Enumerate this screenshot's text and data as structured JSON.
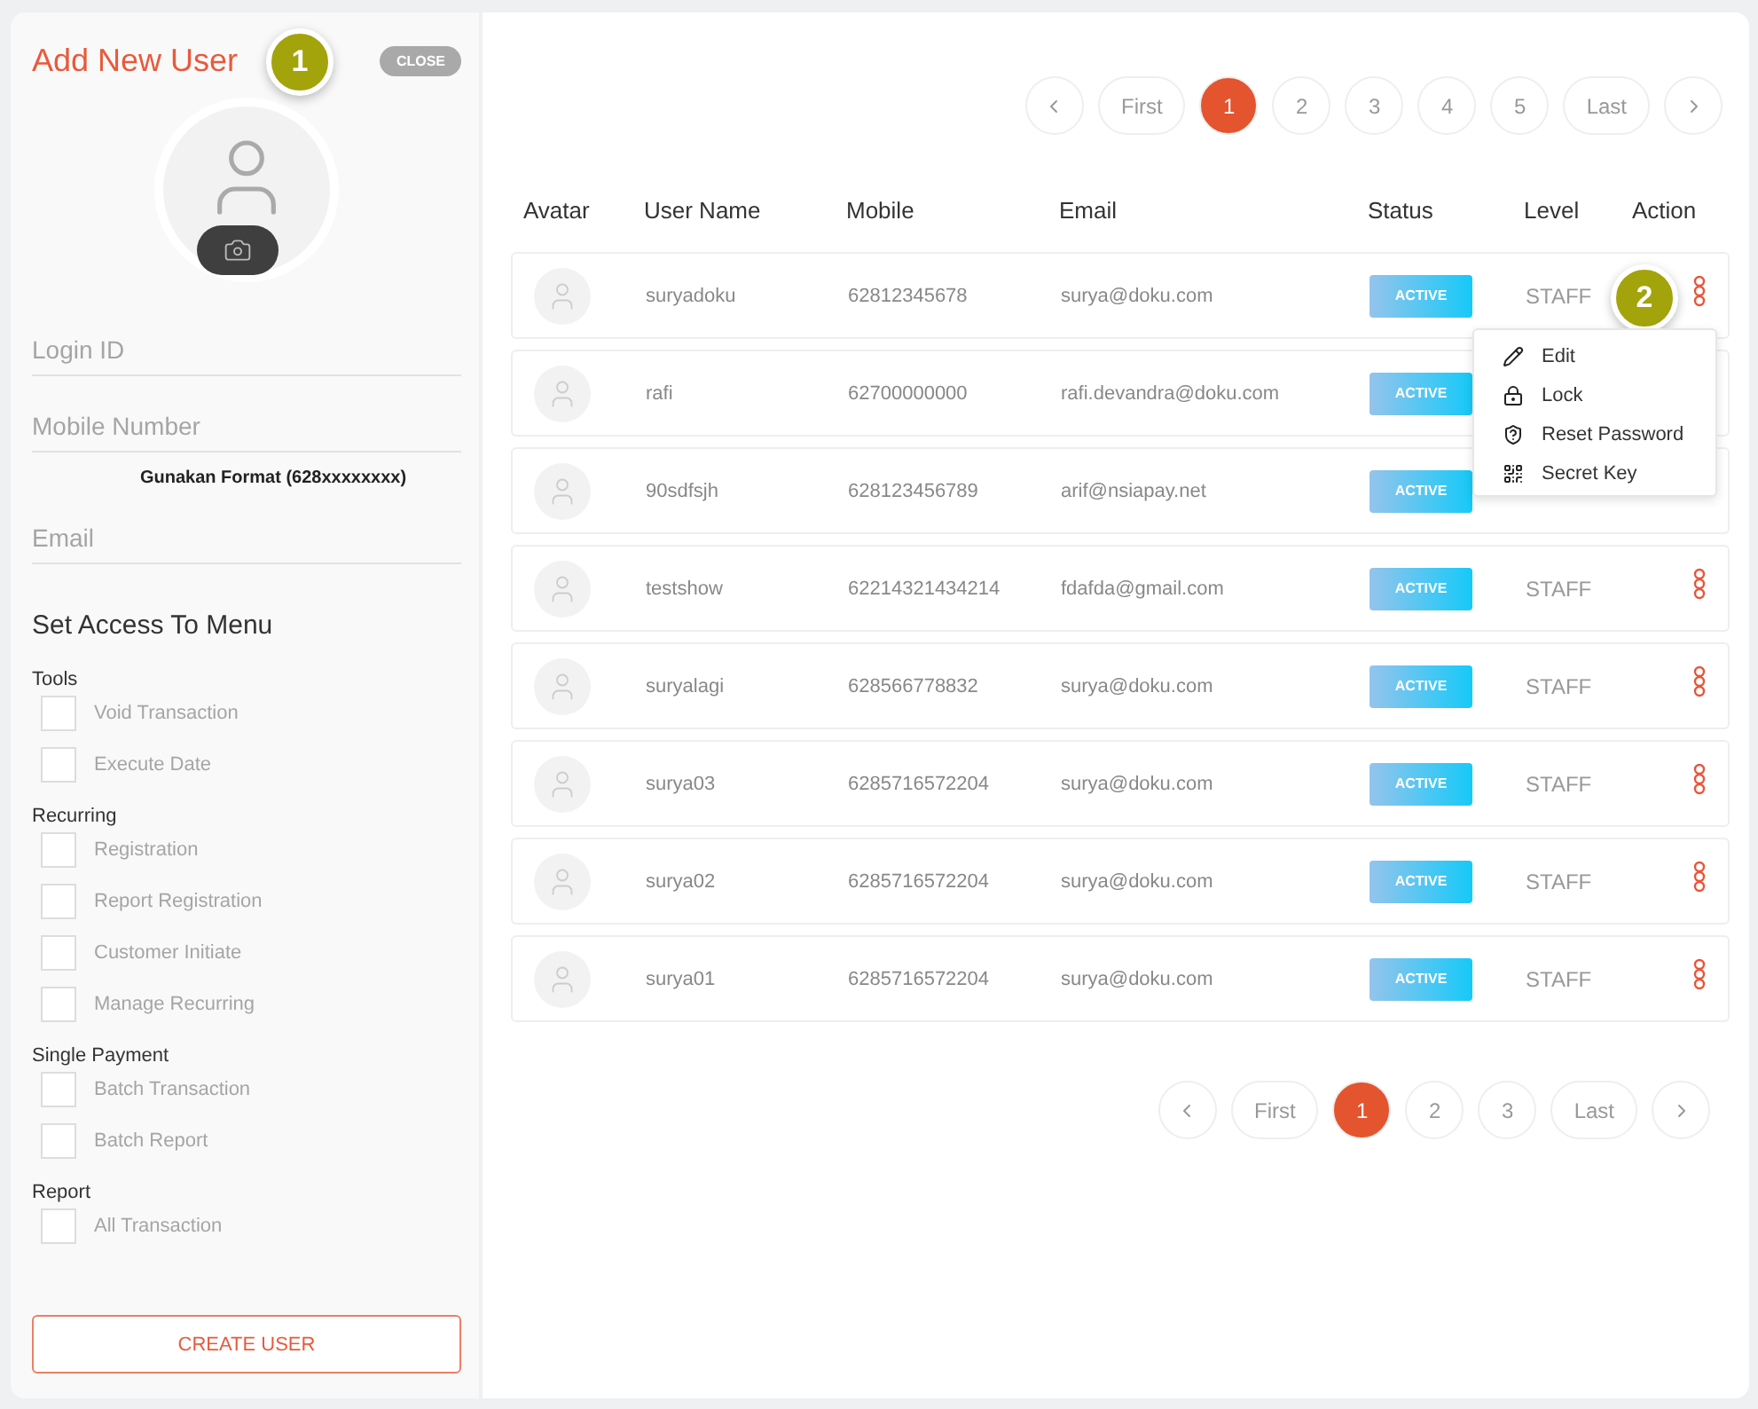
{
  "form": {
    "title": "Add New User",
    "callout": "1",
    "close_label": "CLOSE",
    "fields": [
      {
        "placeholder": "Login ID"
      },
      {
        "placeholder": "Mobile Number",
        "hint": "Gunakan Format (628xxxxxxxx)"
      },
      {
        "placeholder": "Email"
      }
    ],
    "access_title": "Set Access To Menu",
    "groups": [
      {
        "label": "Tools",
        "items": [
          {
            "label": "Void Transaction",
            "checked": false
          },
          {
            "label": "Execute Date",
            "checked": false
          }
        ]
      },
      {
        "label": "Recurring",
        "items": [
          {
            "label": "Registration",
            "checked": false
          },
          {
            "label": "Report Registration",
            "checked": false
          },
          {
            "label": "Customer Initiate",
            "checked": false
          },
          {
            "label": "Manage Recurring",
            "checked": false
          }
        ]
      },
      {
        "label": "Single Payment",
        "items": [
          {
            "label": "Batch Transaction",
            "checked": false
          },
          {
            "label": "Batch Report",
            "checked": false
          }
        ]
      },
      {
        "label": "Report",
        "items": [
          {
            "label": "All Transaction",
            "checked": false
          }
        ]
      }
    ],
    "submit": "CREATE USER"
  },
  "pagination_top": [
    {
      "kind": "prev"
    },
    {
      "kind": "page",
      "label": "First",
      "selected": false
    },
    {
      "kind": "page",
      "label": "1",
      "selected": true
    },
    {
      "kind": "page",
      "label": "2",
      "selected": false
    },
    {
      "kind": "page",
      "label": "3",
      "selected": false
    },
    {
      "kind": "page",
      "label": "4",
      "selected": false
    },
    {
      "kind": "page",
      "label": "5",
      "selected": false
    },
    {
      "kind": "page",
      "label": "Last",
      "selected": false
    },
    {
      "kind": "next"
    }
  ],
  "table": {
    "columns": [
      "Avatar",
      "User Name",
      "Mobile",
      "Email",
      "Status",
      "Level",
      "Action"
    ],
    "rows": [
      {
        "user": "suryadoku",
        "mobile": "62812345678",
        "email": "surya@doku.com",
        "status": "ACTIVE",
        "level": "STAFF",
        "callout": "2"
      },
      {
        "user": "rafi",
        "mobile": "62700000000",
        "email": "rafi.devandra@doku.com",
        "status": "ACTIVE"
      },
      {
        "user": "90sdfsjh",
        "mobile": "628123456789",
        "email": "arif@nsiapay.net",
        "status": "ACTIVE"
      },
      {
        "user": "testshow",
        "mobile": "62214321434214",
        "email": "fdafda@gmail.com",
        "status": "ACTIVE",
        "level": "STAFF"
      },
      {
        "user": "suryalagi",
        "mobile": "628566778832",
        "email": "surya@doku.com",
        "status": "ACTIVE",
        "level": "STAFF"
      },
      {
        "user": "surya03",
        "mobile": "6285716572204",
        "email": "surya@doku.com",
        "status": "ACTIVE",
        "level": "STAFF"
      },
      {
        "user": "surya02",
        "mobile": "6285716572204",
        "email": "surya@doku.com",
        "status": "ACTIVE",
        "level": "STAFF"
      },
      {
        "user": "surya01",
        "mobile": "6285716572204",
        "email": "surya@doku.com",
        "status": "ACTIVE",
        "level": "STAFF"
      }
    ]
  },
  "action_menu": [
    {
      "kind": "edit",
      "label": "Edit"
    },
    {
      "kind": "lock",
      "label": "Lock"
    },
    {
      "kind": "reset",
      "label": "Reset Password"
    },
    {
      "kind": "key",
      "label": "Secret Key"
    }
  ],
  "pagination_bottom": [
    {
      "kind": "prev"
    },
    {
      "kind": "page",
      "label": "First",
      "selected": false
    },
    {
      "kind": "page",
      "label": "1",
      "selected": true
    },
    {
      "kind": "page",
      "label": "2",
      "selected": false
    },
    {
      "kind": "page",
      "label": "3",
      "selected": false
    },
    {
      "kind": "page",
      "label": "Last",
      "selected": false
    },
    {
      "kind": "next"
    }
  ]
}
